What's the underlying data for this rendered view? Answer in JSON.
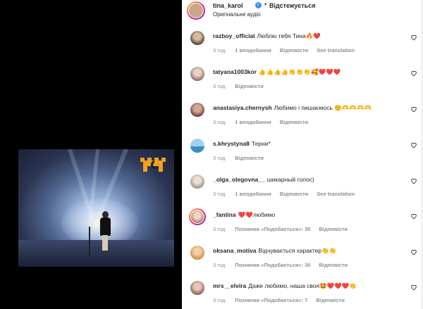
{
  "header": {
    "username": "tina_karol",
    "dot": "•",
    "follow_label": "Відстежується",
    "audio_label": "Оригінальне аудіо"
  },
  "comments": [
    {
      "username": "razboy_official",
      "text": "Люблю тебя Тина🔥❤️",
      "time": "3 год.",
      "likes": "1 вподобання",
      "reply": "Відповісти",
      "translate": "See translation"
    },
    {
      "username": "tatyana1003kor",
      "text": "👍👍👍👍👏👏👏🥰❤️❤️❤️",
      "time": "3 год.",
      "reply": "Відповісти"
    },
    {
      "username": "anastasiya.chernysh",
      "text": "Любимо і пишаємось ☺️🫶🫶🫶🫶",
      "time": "3 год.",
      "likes": "1 вподобання",
      "reply": "Відповісти"
    },
    {
      "username": "s.khrystyna8",
      "text": "Терни*",
      "time": "3 год.",
      "reply": "Відповісти"
    },
    {
      "username": "_olga_olegovna__",
      "text": "шикарный голос)",
      "time": "3 год.",
      "likes": "1 вподобання",
      "reply": "Відповісти",
      "translate": "See translation"
    },
    {
      "username": "_fantina",
      "text": "❤️❤️любимо",
      "time": "3 год.",
      "likes": "Позначки «Подобається»: 35",
      "reply": "Відповісти"
    },
    {
      "username": "oksana_motiva",
      "text": "Відчувається характер👏👏",
      "time": "3 год.",
      "likes": "Позначки «Подобається»: 30",
      "reply": "Відповісти"
    },
    {
      "username": "mrs__elvira",
      "text": "Даже любимо, наша своя🤩❤️❤️❤️👏",
      "time": "3 год.",
      "likes": "Позначки «Подобається»: 7",
      "reply": "Відповісти"
    }
  ],
  "colors": {
    "verified": "#3897f0",
    "logo": "#f0a020",
    "muted_text": "#8e8e8e"
  },
  "icons": {
    "like": "heart-outline-icon",
    "verified": "verified-badge-icon"
  }
}
